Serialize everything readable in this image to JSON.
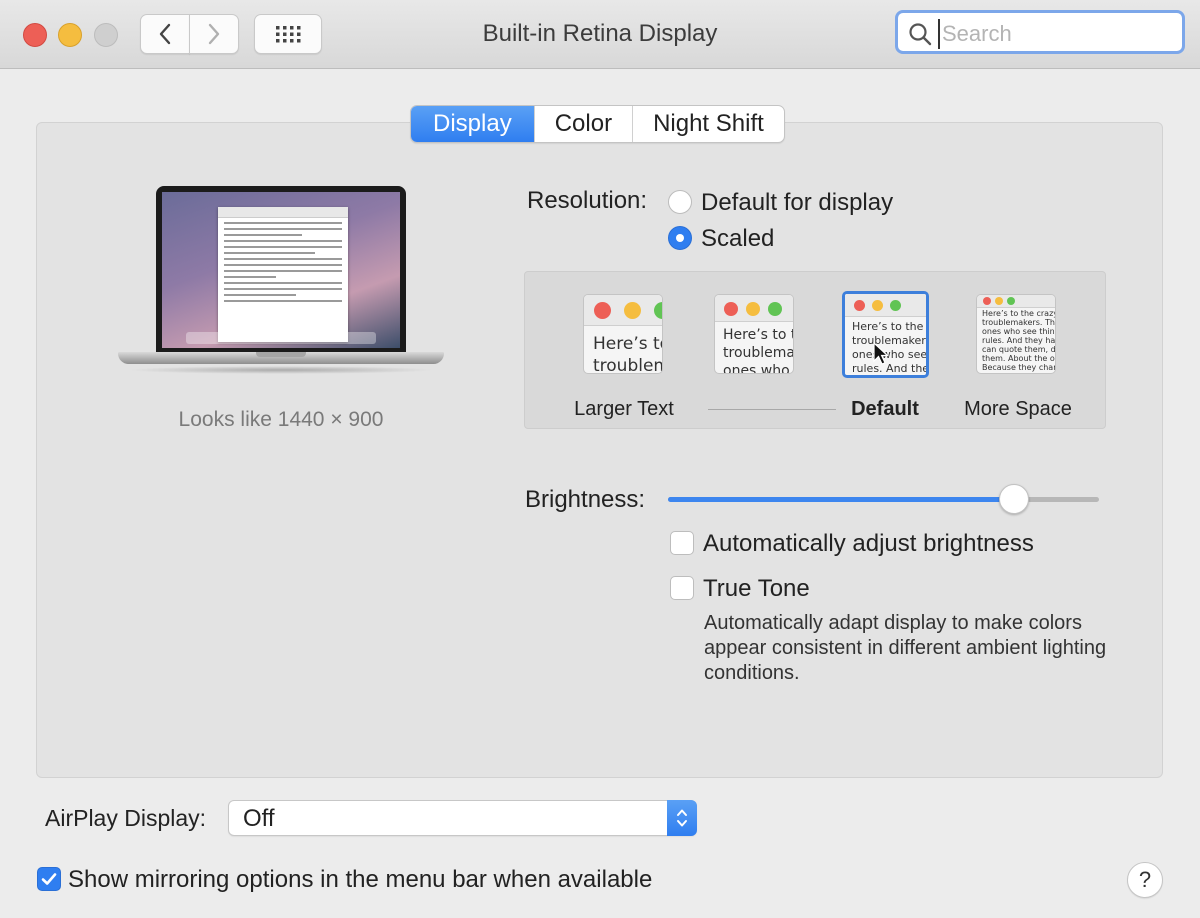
{
  "window": {
    "title": "Built-in Retina Display"
  },
  "search": {
    "placeholder": "Search"
  },
  "tabs": [
    {
      "label": "Display",
      "active": true
    },
    {
      "label": "Color",
      "active": false
    },
    {
      "label": "Night Shift",
      "active": false
    }
  ],
  "display_preview": {
    "looks_like": "Looks like 1440 × 900"
  },
  "resolution": {
    "label": "Resolution:",
    "options": [
      {
        "label": "Default for display",
        "selected": false
      },
      {
        "label": "Scaled",
        "selected": true
      }
    ],
    "scale_options": [
      {
        "label": "Larger Text",
        "preview_text": [
          "Here’s to",
          "troublem"
        ],
        "selected": false
      },
      {
        "label": "",
        "preview_text": [
          "Here’s to t",
          "troublema",
          "ones who"
        ],
        "selected": false
      },
      {
        "label": "Default",
        "preview_text": [
          "Here’s to the cr",
          "troublemakers.",
          "ones who see t",
          "rules. And they"
        ],
        "selected": true
      },
      {
        "label": "More Space",
        "preview_text": [
          "Here’s to the crazy one",
          "troublemakers. The rou",
          "ones who see things di",
          "rules. And they have n",
          "can quote them, disagre",
          "them. About the only th",
          "Because they change th"
        ],
        "selected": false
      }
    ]
  },
  "brightness": {
    "label": "Brightness:",
    "level": 0.8,
    "auto_adjust": {
      "label": "Automatically adjust brightness",
      "checked": false
    },
    "true_tone": {
      "label": "True Tone",
      "checked": false,
      "description": "Automatically adapt display to make colors appear consistent in different ambient lighting conditions."
    }
  },
  "airplay": {
    "label": "AirPlay Display:",
    "value": "Off"
  },
  "mirroring": {
    "label": "Show mirroring options in the menu bar when available",
    "checked": true
  },
  "help": {
    "label": "?"
  },
  "colors": {
    "accent": "#2f7ef0",
    "close": "#ed5f56",
    "minimize": "#f5bd3f",
    "zoom_inactive": "#cfcfcf"
  }
}
